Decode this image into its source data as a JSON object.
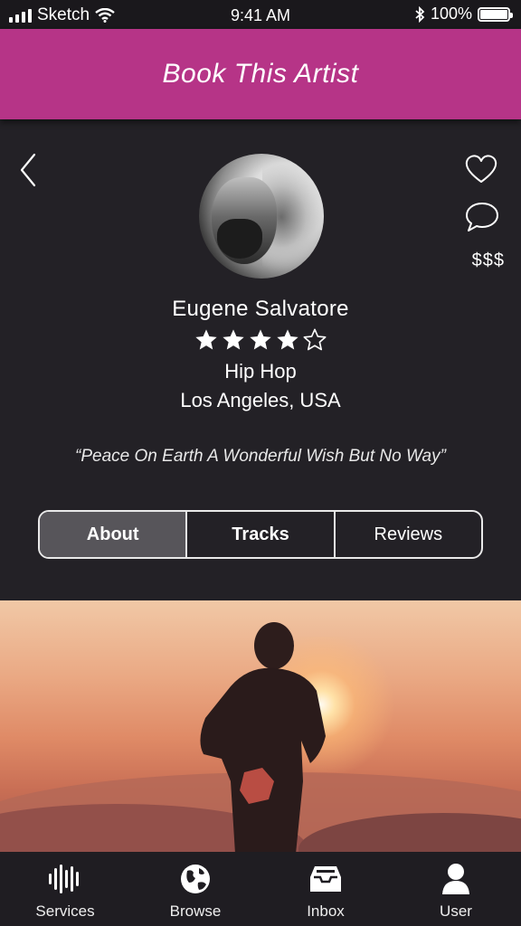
{
  "status_bar": {
    "carrier": "Sketch",
    "time": "9:41 AM",
    "battery": "100%"
  },
  "header": {
    "title": "Book This Artist"
  },
  "actions": {
    "price": "$$$",
    "icons": [
      "back-chevron-icon",
      "heart-icon",
      "chat-bubble-icon"
    ]
  },
  "artist": {
    "name": "Eugene Salvatore",
    "rating": 4,
    "rating_max": 5,
    "genre": "Hip Hop",
    "location": "Los Angeles, USA",
    "quote": "“Peace On Earth A Wonderful Wish But No Way”"
  },
  "tabs": [
    {
      "label": "About",
      "active": true
    },
    {
      "label": "Tracks",
      "active": false
    },
    {
      "label": "Reviews",
      "active": false
    }
  ],
  "bottom_nav": [
    {
      "label": "Services",
      "icon": "sound-wave-icon"
    },
    {
      "label": "Browse",
      "icon": "globe-icon"
    },
    {
      "label": "Inbox",
      "icon": "inbox-tray-icon"
    },
    {
      "label": "User",
      "icon": "user-icon"
    }
  ],
  "colors": {
    "accent": "#b63487",
    "background": "#232126",
    "active_tab": "#57555a"
  }
}
